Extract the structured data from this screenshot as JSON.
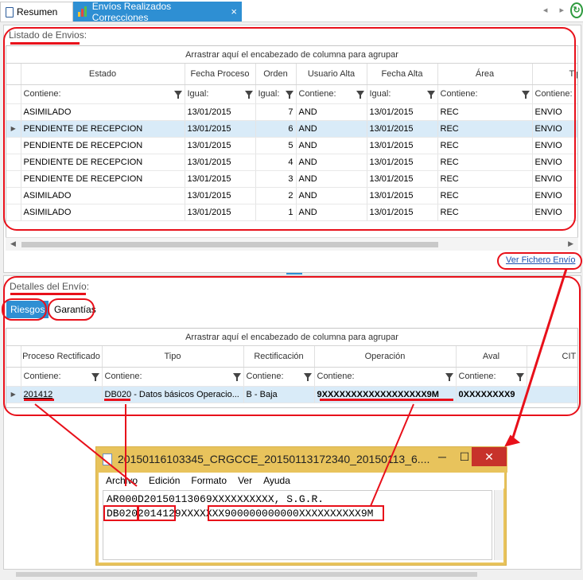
{
  "tabs": [
    {
      "label": "Resumen"
    },
    {
      "label": "Envíos Realizados Correcciones",
      "close": "×"
    }
  ],
  "tab_nav": "◂ ▸",
  "listado": {
    "title": "Listado de Envios:",
    "group_hint": "Arrastrar aquí el encabezado de columna para agrupar",
    "columns": [
      "Estado",
      "Fecha Proceso",
      "Orden",
      "Usuario Alta",
      "Fecha Alta",
      "Área",
      "Tipo"
    ],
    "filters": [
      "Contiene:",
      "Igual:",
      "Igual:",
      "Contiene:",
      "Igual:",
      "Contiene:",
      "Contiene:"
    ],
    "rows": [
      [
        "ASIMILADO",
        "13/01/2015",
        "7",
        "AND",
        "13/01/2015",
        "REC",
        "ENVIO"
      ],
      [
        "PENDIENTE DE RECEPCION",
        "13/01/2015",
        "6",
        "AND",
        "13/01/2015",
        "REC",
        "ENVIO"
      ],
      [
        "PENDIENTE DE RECEPCION",
        "13/01/2015",
        "5",
        "AND",
        "13/01/2015",
        "REC",
        "ENVIO"
      ],
      [
        "PENDIENTE DE RECEPCION",
        "13/01/2015",
        "4",
        "AND",
        "13/01/2015",
        "REC",
        "ENVIO"
      ],
      [
        "PENDIENTE DE RECEPCION",
        "13/01/2015",
        "3",
        "AND",
        "13/01/2015",
        "REC",
        "ENVIO"
      ],
      [
        "ASIMILADO",
        "13/01/2015",
        "2",
        "AND",
        "13/01/2015",
        "REC",
        "ENVIO"
      ],
      [
        "ASIMILADO",
        "13/01/2015",
        "1",
        "AND",
        "13/01/2015",
        "REC",
        "ENVIO"
      ]
    ],
    "selected_row": 1
  },
  "ver_fichero": "Ver Fichero Envío",
  "detalles": {
    "title": "Detalles del Envío:",
    "tab_riesgos": "Riesgos",
    "tab_garantias": "Garantías",
    "group_hint": "Arrastrar aquí el encabezado de columna para agrupar",
    "columns": [
      "Proceso Rectificado",
      "Tipo",
      "Rectificación",
      "Operación",
      "Aval",
      "CIT"
    ],
    "filters": [
      "Contiene:",
      "Contiene:",
      "Contiene:",
      "Contiene:",
      "Contiene:",
      ""
    ],
    "row": [
      "201412",
      "DB020 - Datos básicos Operacio...",
      "B - Baja",
      "9XXXXXXXXXXXXXXXXXX9M",
      "0XXXXXXXX9",
      ""
    ]
  },
  "notepad": {
    "title": "20150116103345_CRGCCE_20150113172340_20150113_6....",
    "menu": [
      "Archivo",
      "Edición",
      "Formato",
      "Ver",
      "Ayuda"
    ],
    "line1": "AR000D20150113069XXXXXXXXXX, S.G.R.",
    "line2": "DB0202014129XXXXXXX900000000000XXXXXXXXXX9M"
  },
  "colors": {
    "accent": "#2e8fd3",
    "selection": "#d9ebf8",
    "annotation": "#e8101a",
    "notepad": "#e8c35c"
  }
}
